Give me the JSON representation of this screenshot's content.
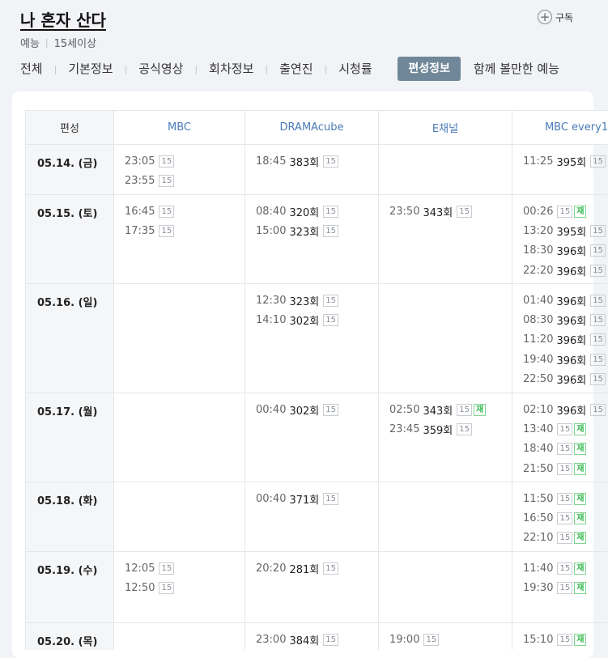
{
  "header": {
    "title": "나 혼자 산다",
    "genre": "예능",
    "rating": "15세이상",
    "subscribe_label": "구독",
    "subscribe_icon": "+"
  },
  "tabs": [
    {
      "label": "전체",
      "active": false
    },
    {
      "label": "기본정보",
      "active": false
    },
    {
      "label": "공식영상",
      "active": false
    },
    {
      "label": "회차정보",
      "active": false
    },
    {
      "label": "출연진",
      "active": false
    },
    {
      "label": "시청률",
      "active": false
    },
    {
      "label": "편성정보",
      "active": true
    },
    {
      "label": "함께 볼만한 예능",
      "active": false
    }
  ],
  "schedule": {
    "corner_label": "편성",
    "channels": [
      "MBC",
      "DRAMAcube",
      "E채널",
      "MBC every1"
    ],
    "rows": [
      {
        "date": "05.14. (금)",
        "row_height": 62,
        "cells": [
          [
            {
              "time": "23:05",
              "ep": "",
              "age": "15",
              "rerun": false
            },
            {
              "time": "23:55",
              "ep": "",
              "age": "15",
              "rerun": false
            }
          ],
          [
            {
              "time": "18:45",
              "ep": "383회",
              "age": "15",
              "rerun": false
            }
          ],
          [],
          [
            {
              "time": "11:25",
              "ep": "395회",
              "age": "15",
              "rerun": false
            }
          ]
        ]
      },
      {
        "date": "05.15. (토)",
        "row_height": 110,
        "cells": [
          [
            {
              "time": "16:45",
              "ep": "",
              "age": "15",
              "rerun": false
            },
            {
              "time": "17:35",
              "ep": "",
              "age": "15",
              "rerun": false
            }
          ],
          [
            {
              "time": "08:40",
              "ep": "320회",
              "age": "15",
              "rerun": false
            },
            {
              "time": "15:00",
              "ep": "323회",
              "age": "15",
              "rerun": false
            }
          ],
          [
            {
              "time": "23:50",
              "ep": "343회",
              "age": "15",
              "rerun": false
            }
          ],
          [
            {
              "time": "00:26",
              "ep": "",
              "age": "15",
              "rerun": true
            },
            {
              "time": "13:20",
              "ep": "395회",
              "age": "15",
              "rerun": false
            },
            {
              "time": "18:30",
              "ep": "396회",
              "age": "15",
              "rerun": false
            },
            {
              "time": "22:20",
              "ep": "396회",
              "age": "15",
              "rerun": false
            }
          ]
        ]
      },
      {
        "date": "05.16. (일)",
        "row_height": 135,
        "cells": [
          [],
          [
            {
              "time": "12:30",
              "ep": "323회",
              "age": "15",
              "rerun": false
            },
            {
              "time": "14:10",
              "ep": "302회",
              "age": "15",
              "rerun": false
            }
          ],
          [],
          [
            {
              "time": "01:40",
              "ep": "396회",
              "age": "15",
              "rerun": false
            },
            {
              "time": "08:30",
              "ep": "396회",
              "age": "15",
              "rerun": false
            },
            {
              "time": "11:20",
              "ep": "396회",
              "age": "15",
              "rerun": false
            },
            {
              "time": "19:40",
              "ep": "396회",
              "age": "15",
              "rerun": false
            },
            {
              "time": "22:50",
              "ep": "396회",
              "age": "15",
              "rerun": false
            }
          ]
        ]
      },
      {
        "date": "05.17. (월)",
        "row_height": 110,
        "cells": [
          [],
          [
            {
              "time": "00:40",
              "ep": "302회",
              "age": "15",
              "rerun": false
            }
          ],
          [
            {
              "time": "02:50",
              "ep": "343회",
              "age": "15",
              "rerun": true
            },
            {
              "time": "23:45",
              "ep": "359회",
              "age": "15",
              "rerun": false
            }
          ],
          [
            {
              "time": "02:10",
              "ep": "396회",
              "age": "15",
              "rerun": false
            },
            {
              "time": "13:40",
              "ep": "",
              "age": "15",
              "rerun": true
            },
            {
              "time": "18:40",
              "ep": "",
              "age": "15",
              "rerun": true
            },
            {
              "time": "21:50",
              "ep": "",
              "age": "15",
              "rerun": true
            }
          ]
        ]
      },
      {
        "date": "05.18. (화)",
        "row_height": 86,
        "cells": [
          [],
          [
            {
              "time": "00:40",
              "ep": "371회",
              "age": "15",
              "rerun": false
            }
          ],
          [],
          [
            {
              "time": "11:50",
              "ep": "",
              "age": "15",
              "rerun": true
            },
            {
              "time": "16:50",
              "ep": "",
              "age": "15",
              "rerun": true
            },
            {
              "time": "22:10",
              "ep": "",
              "age": "15",
              "rerun": true
            }
          ]
        ]
      },
      {
        "date": "05.19. (수)",
        "row_height": 88,
        "cells": [
          [
            {
              "time": "12:05",
              "ep": "",
              "age": "15",
              "rerun": false
            },
            {
              "time": "12:50",
              "ep": "",
              "age": "15",
              "rerun": false
            }
          ],
          [
            {
              "time": "20:20",
              "ep": "281회",
              "age": "15",
              "rerun": false
            }
          ],
          [],
          [
            {
              "time": "11:40",
              "ep": "",
              "age": "15",
              "rerun": true
            },
            {
              "time": "19:30",
              "ep": "",
              "age": "15",
              "rerun": true
            }
          ]
        ]
      },
      {
        "date": "05.20. (목)",
        "row_height": 70,
        "cells": [
          [],
          [
            {
              "time": "23:00",
              "ep": "384회",
              "age": "15",
              "rerun": false
            }
          ],
          [
            {
              "time": "19:00",
              "ep": "",
              "age": "15",
              "rerun": false
            }
          ],
          [
            {
              "time": "15:10",
              "ep": "",
              "age": "15",
              "rerun": true
            }
          ]
        ]
      }
    ]
  },
  "badges": {
    "rerun_label": "재"
  },
  "colors": {
    "active_tab": "#6f8798",
    "channel_text": "#4a7bb7",
    "rerun_green": "#2eb84a",
    "page_bg": "#f1f3f6"
  }
}
